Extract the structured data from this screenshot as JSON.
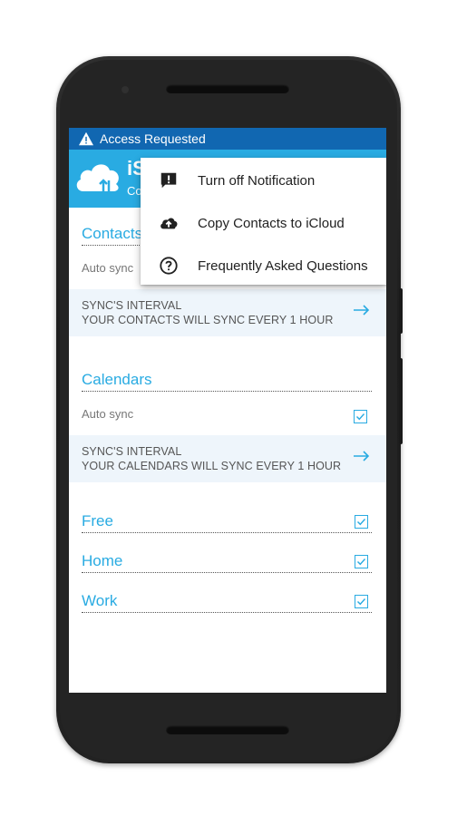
{
  "status_bar": {
    "text": "Access Requested",
    "icon": "warning-icon"
  },
  "app_bar": {
    "title": "iS",
    "subtitle": "Co",
    "icon": "cloud-sync-icon",
    "color": "#29abe2"
  },
  "contacts": {
    "title": "Contacts",
    "auto_sync_label": "Auto sync",
    "interval_line1": "SYNC'S INTERVAL",
    "interval_line2": "YOUR CONTACTS WILL SYNC EVERY 1 HOUR"
  },
  "calendars": {
    "title": "Calendars",
    "auto_sync_label": "Auto sync",
    "auto_sync_checked": true,
    "interval_line1": "SYNC'S INTERVAL",
    "interval_line2": "YOUR CALENDARS WILL SYNC EVERY 1 HOUR",
    "items": [
      {
        "label": "Free",
        "checked": true
      },
      {
        "label": "Home",
        "checked": true
      },
      {
        "label": "Work",
        "checked": true
      }
    ]
  },
  "menu": {
    "items": [
      {
        "label": "Turn off Notification",
        "icon": "notification-off-icon"
      },
      {
        "label": "Copy Contacts to iCloud",
        "icon": "cloud-upload-icon"
      },
      {
        "label": "Frequently Asked Questions",
        "icon": "help-icon"
      }
    ]
  },
  "colors": {
    "status_bar": "#1167b1",
    "accent": "#29abe2",
    "interval_bg": "#eef5fb"
  }
}
